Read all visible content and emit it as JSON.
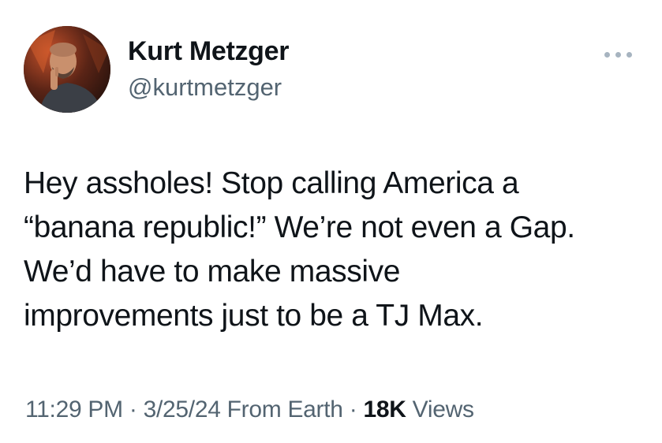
{
  "author": {
    "name": "Kurt Metzger",
    "handle": "@kurtmetzger",
    "avatar_icon": "profile-photo"
  },
  "more_icon": "more-options-icon",
  "tweet": {
    "lines": [
      "Hey assholes! Stop calling America a",
      "“banana republic!” We’re not even a Gap.",
      "We’d have to make massive",
      "improvements just to be a TJ Max."
    ]
  },
  "meta": {
    "time": "11:29 PM",
    "separator": "·",
    "date": "3/25/24",
    "source": "From Earth",
    "views_count": "18K",
    "views_label": "Views"
  },
  "colors": {
    "text": "#0f1419",
    "secondary": "#536471",
    "background": "#ffffff"
  }
}
